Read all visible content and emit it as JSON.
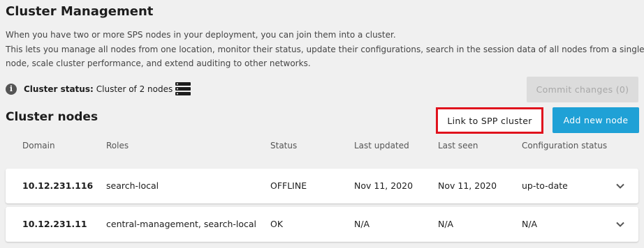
{
  "page": {
    "title": "Cluster Management",
    "description": [
      "When you have two or more SPS nodes in your deployment, you can join them into a cluster.",
      "This lets you manage all nodes from one location, monitor their status, update their configurations, search in the session data of all nodes from a single",
      "node, scale cluster performance, and extend auditing to other networks."
    ]
  },
  "cluster_status": {
    "label": "Cluster status:",
    "value": "Cluster of 2 nodes",
    "icon": "server-stack-icon"
  },
  "buttons": {
    "commit": "Commit changes (0)",
    "link_spp": "Link to SPP cluster",
    "add_node": "Add new node"
  },
  "nodes": {
    "title": "Cluster nodes",
    "columns": [
      "Domain",
      "Roles",
      "Status",
      "Last updated",
      "Last seen",
      "Configuration status"
    ],
    "rows": [
      {
        "domain": "10.12.231.116",
        "roles": "search-local",
        "status": "OFFLINE",
        "last_updated": "Nov 11, 2020",
        "last_seen": "Nov 11, 2020",
        "config_status": "up-to-date"
      },
      {
        "domain": "10.12.231.11",
        "roles": "central-management, search-local",
        "status": "OK",
        "last_updated": "N/A",
        "last_seen": "N/A",
        "config_status": "N/A"
      }
    ]
  },
  "colors": {
    "accent": "#1fa1d6",
    "highlight_border": "#e0121d",
    "background": "#f0f0f0",
    "disabled_button": "#dcdcdc"
  }
}
